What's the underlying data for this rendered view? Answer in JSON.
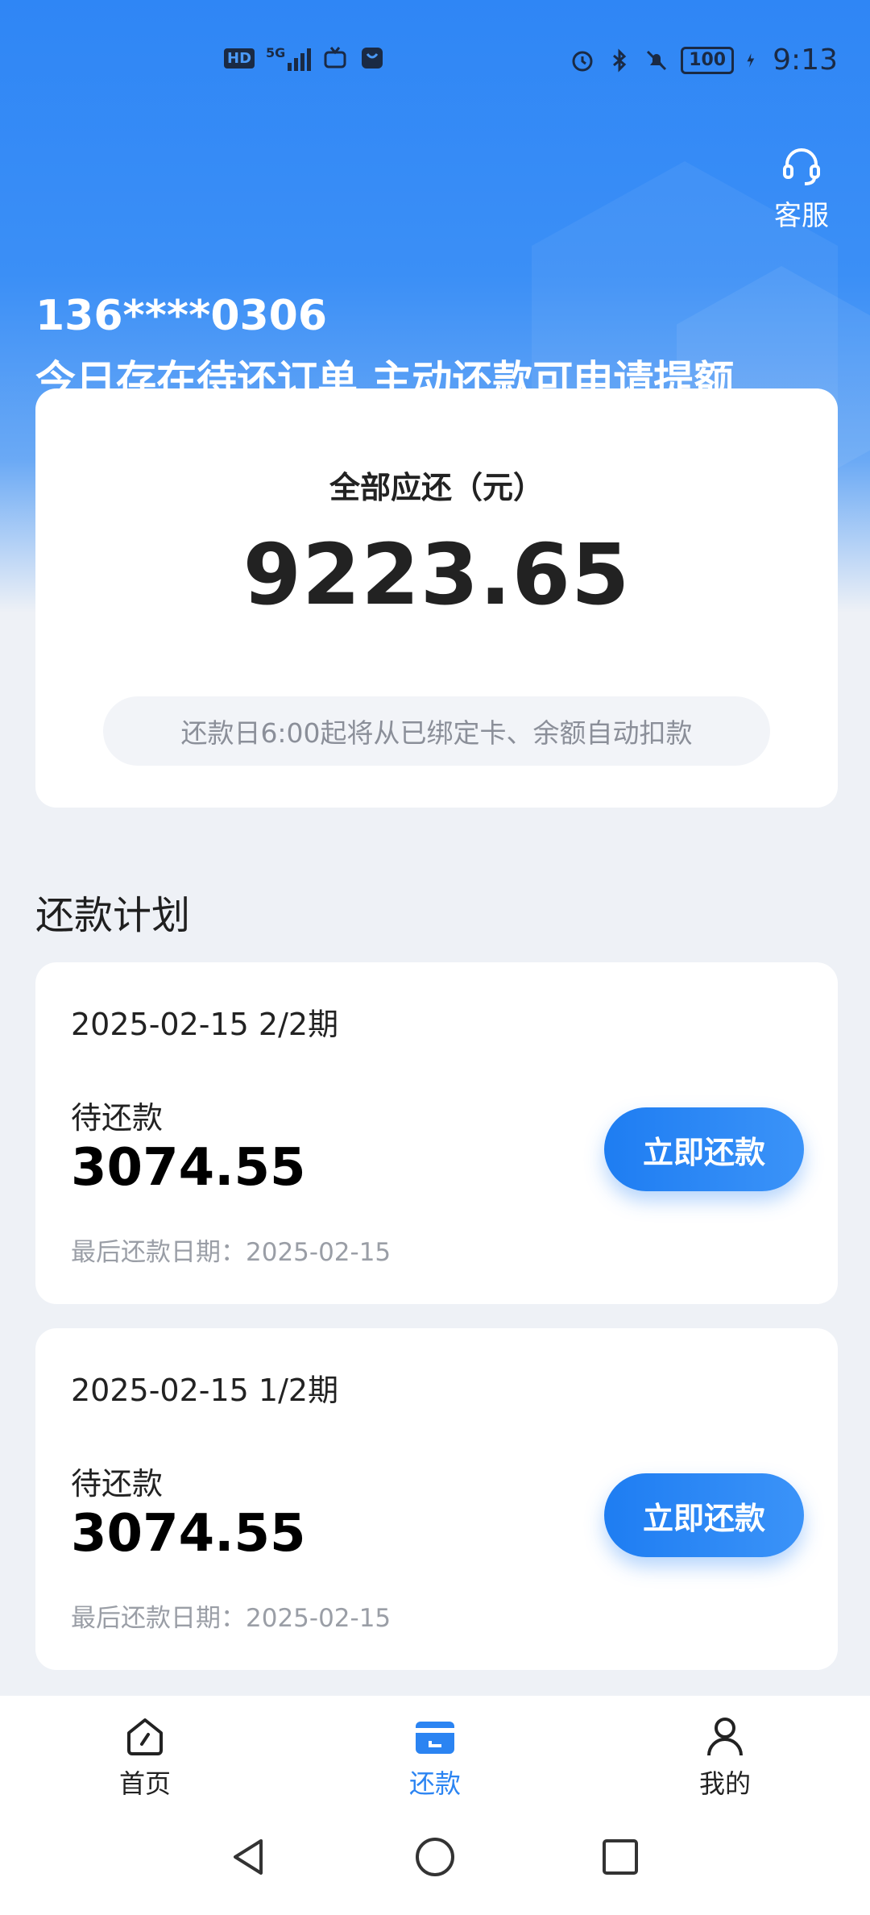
{
  "status_bar": {
    "hd_badge": "HD",
    "net_badge": "5G",
    "battery": "100",
    "time": "9:13",
    "icons": [
      "signal-icon",
      "tv-icon",
      "bag-icon",
      "alarm-icon",
      "bluetooth-icon",
      "mute-icon",
      "charging-icon"
    ]
  },
  "header": {
    "customer_service_label": "客服",
    "phone": "136****0306",
    "notice": "今日存在待还订单 主动还款可申请提额"
  },
  "summary": {
    "label": "全部应还（元）",
    "amount": "9223.65",
    "hint": "还款日6:00起将从已绑定卡、余额自动扣款"
  },
  "plan": {
    "title": "还款计划",
    "items": [
      {
        "period": "2025-02-15 2/2期",
        "due_label": "待还款",
        "amount": "3074.55",
        "last_date": "最后还款日期：2025-02-15",
        "button": "立即还款"
      },
      {
        "period": "2025-02-15 1/2期",
        "due_label": "待还款",
        "amount": "3074.55",
        "last_date": "最后还款日期：2025-02-15",
        "button": "立即还款"
      }
    ]
  },
  "bottom_nav": {
    "items": [
      {
        "label": "首页",
        "icon": "home-icon"
      },
      {
        "label": "还款",
        "icon": "repay-icon",
        "active": true
      },
      {
        "label": "我的",
        "icon": "user-icon"
      }
    ]
  },
  "colors": {
    "primary": "#2b84f2",
    "header_blue": "#2f86f5",
    "background": "#eef1f6"
  }
}
